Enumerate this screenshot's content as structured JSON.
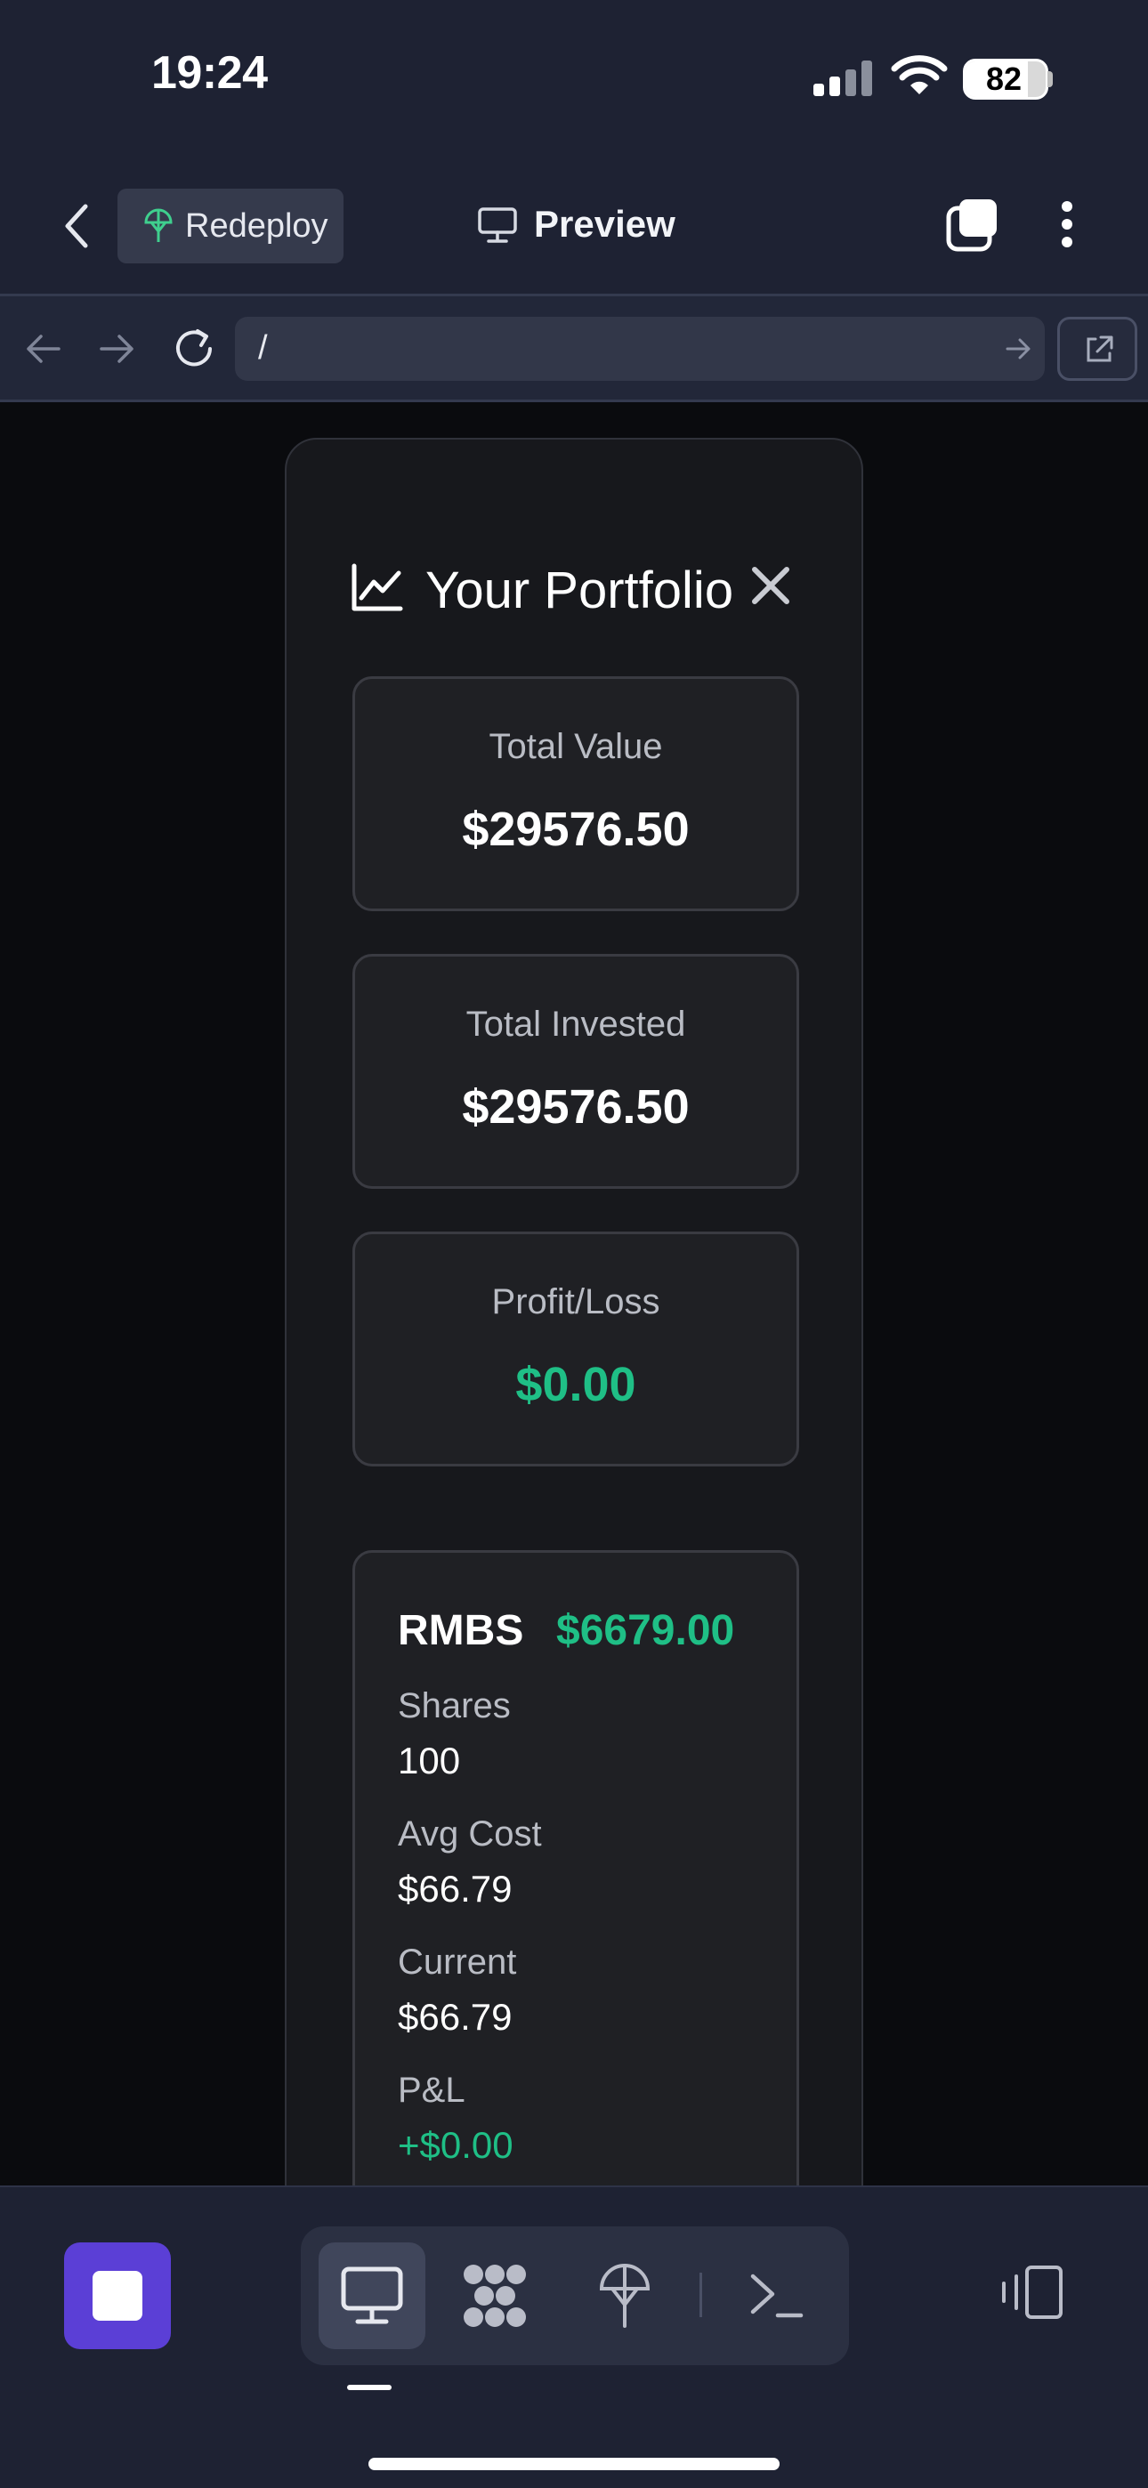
{
  "status_bar": {
    "time": "19:24",
    "battery": "82"
  },
  "header": {
    "back_label": "",
    "redeploy_label": "Redeploy",
    "preview_label": "Preview"
  },
  "url_bar": {
    "url": "/"
  },
  "portfolio": {
    "title": "Your Portfolio",
    "stats": [
      {
        "label": "Total Value",
        "value": "$29576.50",
        "color": "#ffffff"
      },
      {
        "label": "Total Invested",
        "value": "$29576.50",
        "color": "#ffffff"
      },
      {
        "label": "Profit/Loss",
        "value": "$0.00",
        "color": "#1fbf86"
      }
    ],
    "holding": {
      "symbol": "RMBS",
      "market_value": "$6679.00",
      "shares_label": "Shares",
      "shares": "100",
      "avg_cost_label": "Avg Cost",
      "avg_cost": "$66.79",
      "current_label": "Current",
      "current": "$66.79",
      "pl_label": "P&L",
      "pl": "+$0.00"
    }
  },
  "colors": {
    "accent_green": "#1fbf86",
    "stop_purple": "#5b3fd6",
    "chrome_bg": "#1e2233"
  },
  "bottom_tabs": [
    "desktop-icon",
    "apps-icon",
    "deploy-icon",
    "terminal-icon"
  ]
}
